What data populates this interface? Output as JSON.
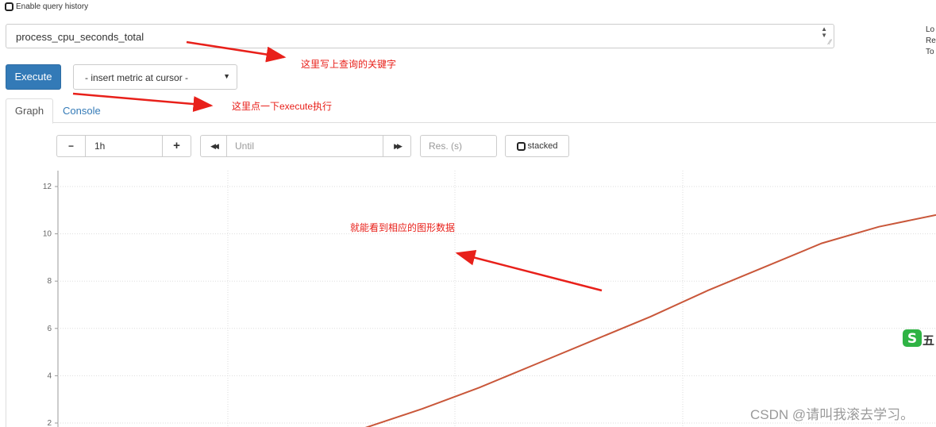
{
  "query_history": {
    "label": "Enable query history"
  },
  "expression": {
    "value": "process_cpu_seconds_total"
  },
  "info_labels": [
    "Lo",
    "Re",
    "To"
  ],
  "toolbar": {
    "execute_label": "Execute",
    "insert_metric_label": "- insert metric at cursor -"
  },
  "tabs": [
    {
      "label": "Graph",
      "active": true
    },
    {
      "label": "Console",
      "active": false
    }
  ],
  "graph_controls": {
    "minus_label": "−",
    "range_value": "1h",
    "plus_label": "+",
    "back_label": "◀◀",
    "until_placeholder": "Until",
    "forward_label": "▶▶",
    "res_placeholder": "Res. (s)",
    "stacked_label": "stacked"
  },
  "annotations": {
    "note_query": "这里写上查询的关键字",
    "note_execute": "这里点一下execute执行",
    "note_graph": "就能看到相应的图形数据",
    "color": "#e8201a"
  },
  "watermark": "CSDN @请叫我滚去学习。",
  "ime_char": "五",
  "colors": {
    "accent": "#337ab7",
    "series": "#c9573a"
  },
  "chart_data": {
    "type": "line",
    "series": [
      {
        "x": [
          0.0,
          0.1,
          0.2,
          0.3,
          0.4,
          0.5,
          0.6,
          0.7,
          0.8,
          0.9,
          1.0
        ],
        "y": [
          1.8,
          2.6,
          3.5,
          4.5,
          5.5,
          6.5,
          7.6,
          8.6,
          9.6,
          10.3,
          10.8
        ]
      }
    ],
    "y_ticks": [
      "2",
      "4",
      "6",
      "8",
      "10",
      "12"
    ],
    "ylim": [
      1.8,
      12.0
    ],
    "grid": true
  }
}
